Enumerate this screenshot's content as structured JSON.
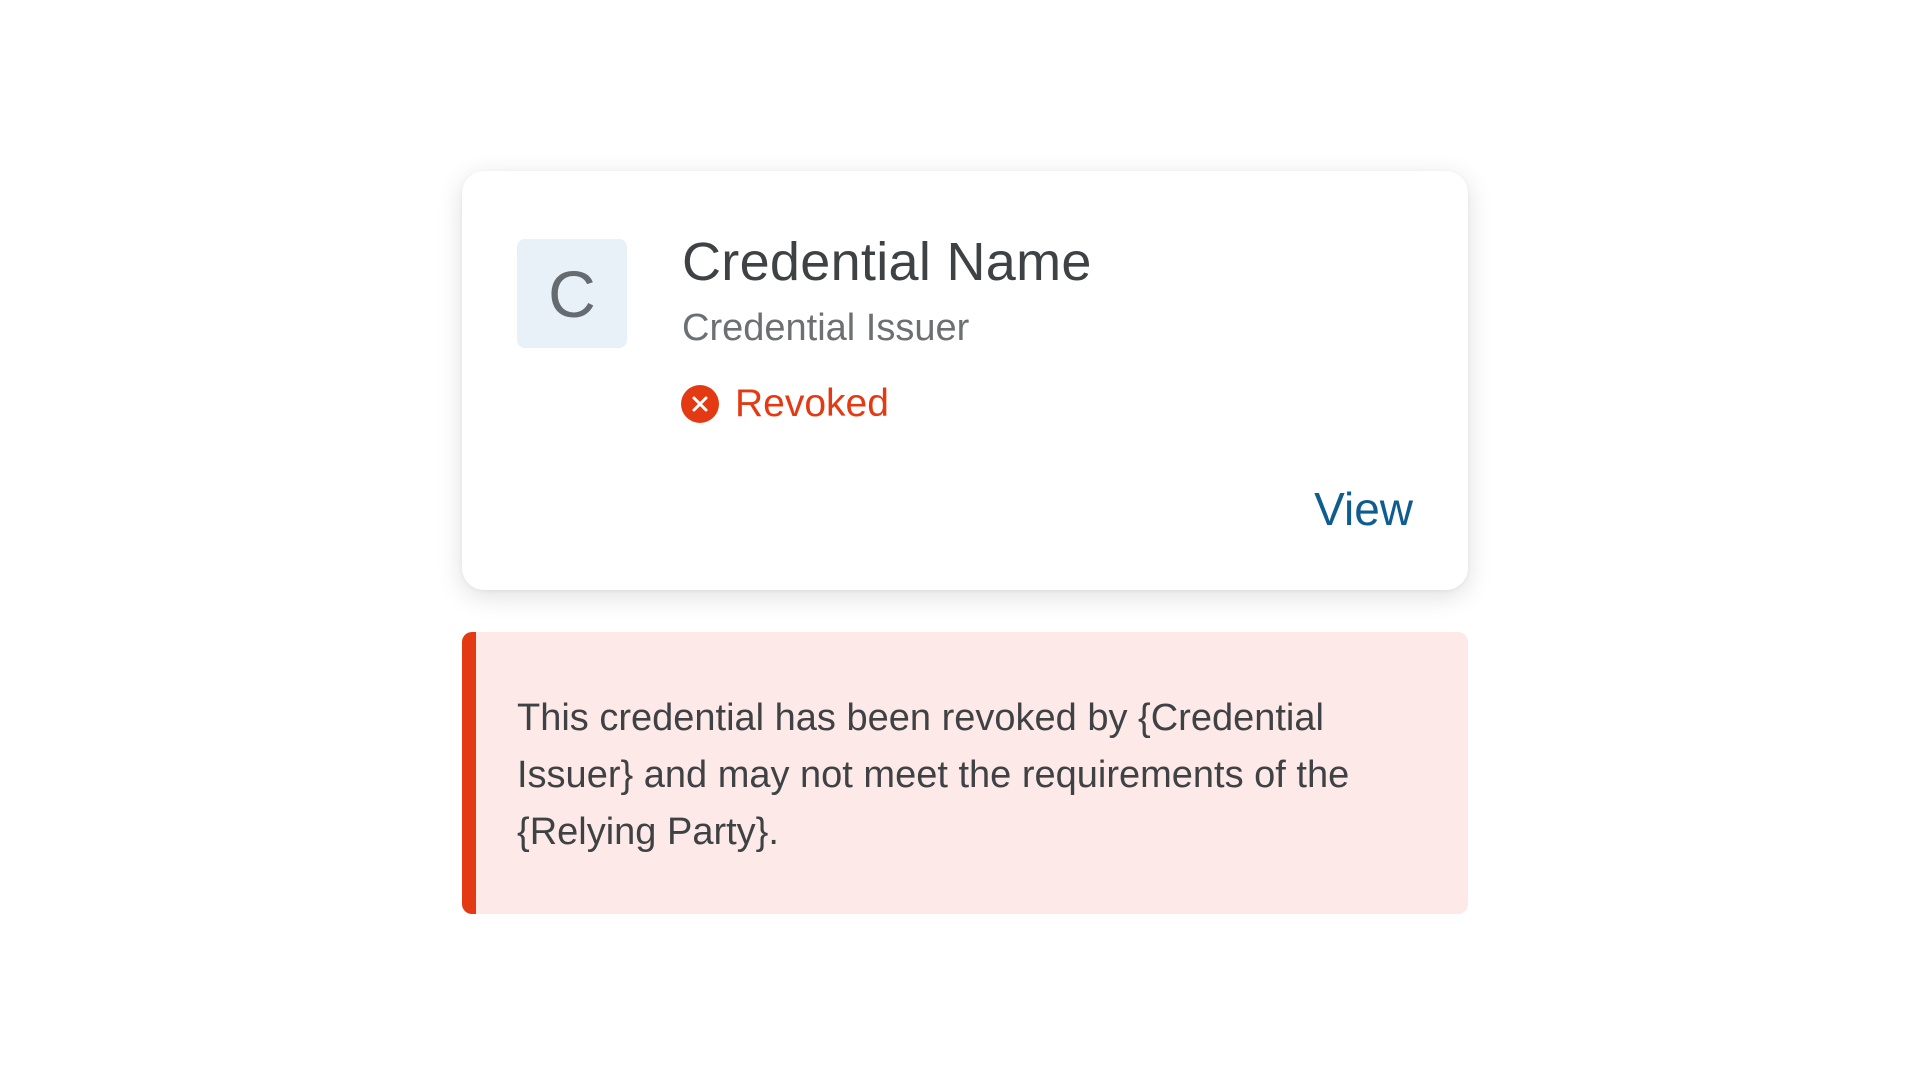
{
  "credential": {
    "avatar_letter": "C",
    "name": "Credential Name",
    "issuer": "Credential Issuer",
    "status": {
      "label": "Revoked",
      "icon": "x-circle-icon",
      "color": "#e43a13"
    },
    "view_label": "View"
  },
  "alert": {
    "message": "This credential has been revoked by {Credential Issuer} and may not meet the requirements of the {Relying Party}.",
    "accent_color": "#e43a13",
    "background_color": "#fde9e7"
  },
  "colors": {
    "link": "#0f5d8f",
    "text_primary": "#3f4245",
    "text_secondary": "#6c7073",
    "avatar_bg": "#e8f1f8"
  }
}
